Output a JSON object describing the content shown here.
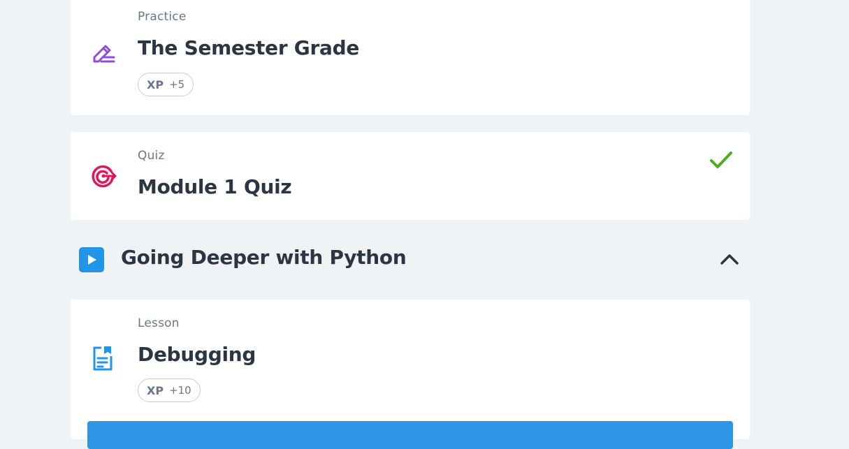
{
  "items": [
    {
      "type_label": "Practice",
      "title": "The Semester Grade",
      "xp_label": "XP",
      "xp_value": "+5",
      "icon": "pencil-lines-icon",
      "icon_color": "#8b4fd6"
    },
    {
      "type_label": "Quiz",
      "title": "Module 1 Quiz",
      "icon": "target-arrow-icon",
      "icon_color": "#e2155b",
      "completed": true,
      "check_color": "#4caf1a"
    }
  ],
  "chapter": {
    "title": "Going Deeper with Python",
    "icon": "play-icon",
    "icon_color": "#2196e8",
    "toggle_icon": "chevron-up-icon"
  },
  "lesson": {
    "type_label": "Lesson",
    "title": "Debugging",
    "xp_label": "XP",
    "xp_value": "+10",
    "icon": "document-bookmark-icon",
    "icon_color": "#2196e8"
  },
  "colors": {
    "background": "#f0f3f6",
    "card": "#ffffff",
    "primary_button": "#2d96e5"
  }
}
